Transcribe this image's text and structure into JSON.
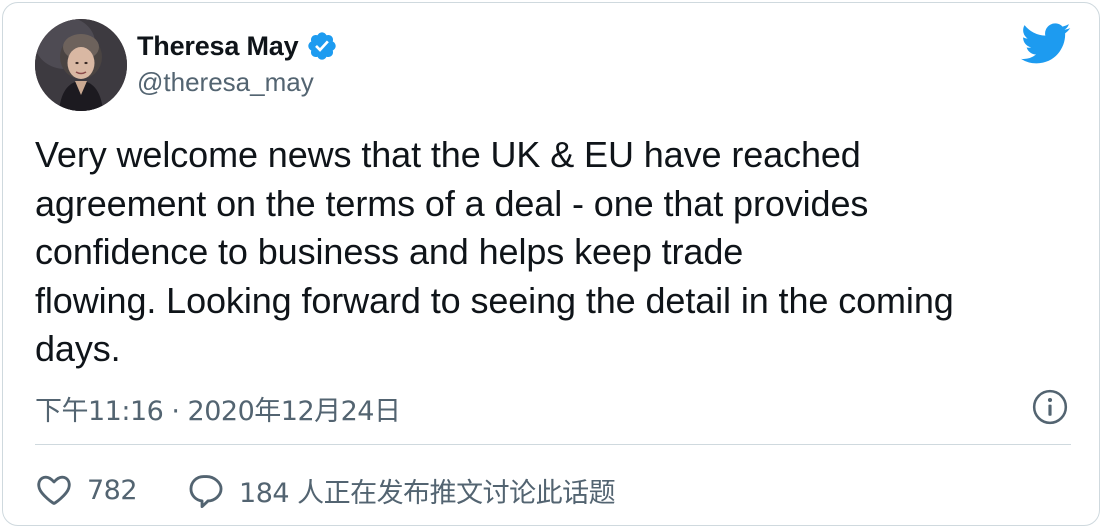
{
  "colors": {
    "text_primary": "#0f1419",
    "text_secondary": "#536471",
    "twitter_blue": "#1d9bf0",
    "border": "#cfd9de"
  },
  "author": {
    "name": "Theresa May",
    "handle": "@theresa_may",
    "verified": true,
    "avatar_icon": "profile-photo"
  },
  "brand_icon": "twitter-bird-icon",
  "tweet": {
    "lines": [
      "Very welcome news that the UK & EU have reached",
      "agreement on the terms of a deal - one that provides",
      "confidence to business and helps keep trade",
      "flowing. Looking forward to seeing the detail in the coming",
      "days."
    ],
    "timestamp": "下午11:16 · 2020年12月24日"
  },
  "info_icon": "info-icon",
  "actions": {
    "like_count": "782",
    "reply_text": "184 人正在发布推文讨论此话题"
  }
}
